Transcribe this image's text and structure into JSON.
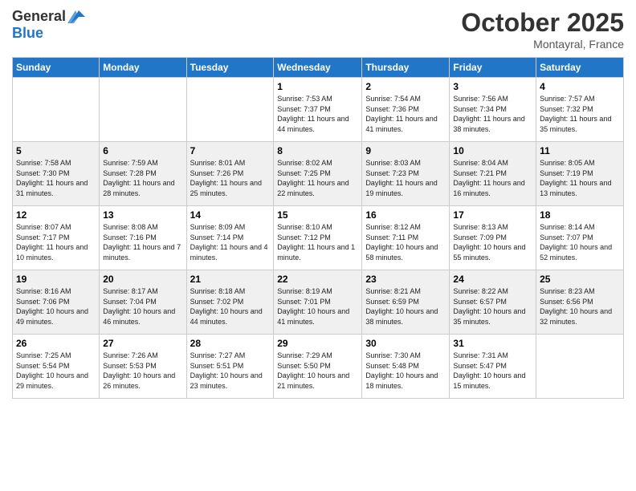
{
  "header": {
    "logo_line1": "General",
    "logo_line2": "Blue",
    "month": "October 2025",
    "location": "Montayral, France"
  },
  "days_of_week": [
    "Sunday",
    "Monday",
    "Tuesday",
    "Wednesday",
    "Thursday",
    "Friday",
    "Saturday"
  ],
  "weeks": [
    [
      {
        "day": "",
        "sunrise": "",
        "sunset": "",
        "daylight": ""
      },
      {
        "day": "",
        "sunrise": "",
        "sunset": "",
        "daylight": ""
      },
      {
        "day": "",
        "sunrise": "",
        "sunset": "",
        "daylight": ""
      },
      {
        "day": "1",
        "sunrise": "Sunrise: 7:53 AM",
        "sunset": "Sunset: 7:37 PM",
        "daylight": "Daylight: 11 hours and 44 minutes."
      },
      {
        "day": "2",
        "sunrise": "Sunrise: 7:54 AM",
        "sunset": "Sunset: 7:36 PM",
        "daylight": "Daylight: 11 hours and 41 minutes."
      },
      {
        "day": "3",
        "sunrise": "Sunrise: 7:56 AM",
        "sunset": "Sunset: 7:34 PM",
        "daylight": "Daylight: 11 hours and 38 minutes."
      },
      {
        "day": "4",
        "sunrise": "Sunrise: 7:57 AM",
        "sunset": "Sunset: 7:32 PM",
        "daylight": "Daylight: 11 hours and 35 minutes."
      }
    ],
    [
      {
        "day": "5",
        "sunrise": "Sunrise: 7:58 AM",
        "sunset": "Sunset: 7:30 PM",
        "daylight": "Daylight: 11 hours and 31 minutes."
      },
      {
        "day": "6",
        "sunrise": "Sunrise: 7:59 AM",
        "sunset": "Sunset: 7:28 PM",
        "daylight": "Daylight: 11 hours and 28 minutes."
      },
      {
        "day": "7",
        "sunrise": "Sunrise: 8:01 AM",
        "sunset": "Sunset: 7:26 PM",
        "daylight": "Daylight: 11 hours and 25 minutes."
      },
      {
        "day": "8",
        "sunrise": "Sunrise: 8:02 AM",
        "sunset": "Sunset: 7:25 PM",
        "daylight": "Daylight: 11 hours and 22 minutes."
      },
      {
        "day": "9",
        "sunrise": "Sunrise: 8:03 AM",
        "sunset": "Sunset: 7:23 PM",
        "daylight": "Daylight: 11 hours and 19 minutes."
      },
      {
        "day": "10",
        "sunrise": "Sunrise: 8:04 AM",
        "sunset": "Sunset: 7:21 PM",
        "daylight": "Daylight: 11 hours and 16 minutes."
      },
      {
        "day": "11",
        "sunrise": "Sunrise: 8:05 AM",
        "sunset": "Sunset: 7:19 PM",
        "daylight": "Daylight: 11 hours and 13 minutes."
      }
    ],
    [
      {
        "day": "12",
        "sunrise": "Sunrise: 8:07 AM",
        "sunset": "Sunset: 7:17 PM",
        "daylight": "Daylight: 11 hours and 10 minutes."
      },
      {
        "day": "13",
        "sunrise": "Sunrise: 8:08 AM",
        "sunset": "Sunset: 7:16 PM",
        "daylight": "Daylight: 11 hours and 7 minutes."
      },
      {
        "day": "14",
        "sunrise": "Sunrise: 8:09 AM",
        "sunset": "Sunset: 7:14 PM",
        "daylight": "Daylight: 11 hours and 4 minutes."
      },
      {
        "day": "15",
        "sunrise": "Sunrise: 8:10 AM",
        "sunset": "Sunset: 7:12 PM",
        "daylight": "Daylight: 11 hours and 1 minute."
      },
      {
        "day": "16",
        "sunrise": "Sunrise: 8:12 AM",
        "sunset": "Sunset: 7:11 PM",
        "daylight": "Daylight: 10 hours and 58 minutes."
      },
      {
        "day": "17",
        "sunrise": "Sunrise: 8:13 AM",
        "sunset": "Sunset: 7:09 PM",
        "daylight": "Daylight: 10 hours and 55 minutes."
      },
      {
        "day": "18",
        "sunrise": "Sunrise: 8:14 AM",
        "sunset": "Sunset: 7:07 PM",
        "daylight": "Daylight: 10 hours and 52 minutes."
      }
    ],
    [
      {
        "day": "19",
        "sunrise": "Sunrise: 8:16 AM",
        "sunset": "Sunset: 7:06 PM",
        "daylight": "Daylight: 10 hours and 49 minutes."
      },
      {
        "day": "20",
        "sunrise": "Sunrise: 8:17 AM",
        "sunset": "Sunset: 7:04 PM",
        "daylight": "Daylight: 10 hours and 46 minutes."
      },
      {
        "day": "21",
        "sunrise": "Sunrise: 8:18 AM",
        "sunset": "Sunset: 7:02 PM",
        "daylight": "Daylight: 10 hours and 44 minutes."
      },
      {
        "day": "22",
        "sunrise": "Sunrise: 8:19 AM",
        "sunset": "Sunset: 7:01 PM",
        "daylight": "Daylight: 10 hours and 41 minutes."
      },
      {
        "day": "23",
        "sunrise": "Sunrise: 8:21 AM",
        "sunset": "Sunset: 6:59 PM",
        "daylight": "Daylight: 10 hours and 38 minutes."
      },
      {
        "day": "24",
        "sunrise": "Sunrise: 8:22 AM",
        "sunset": "Sunset: 6:57 PM",
        "daylight": "Daylight: 10 hours and 35 minutes."
      },
      {
        "day": "25",
        "sunrise": "Sunrise: 8:23 AM",
        "sunset": "Sunset: 6:56 PM",
        "daylight": "Daylight: 10 hours and 32 minutes."
      }
    ],
    [
      {
        "day": "26",
        "sunrise": "Sunrise: 7:25 AM",
        "sunset": "Sunset: 5:54 PM",
        "daylight": "Daylight: 10 hours and 29 minutes."
      },
      {
        "day": "27",
        "sunrise": "Sunrise: 7:26 AM",
        "sunset": "Sunset: 5:53 PM",
        "daylight": "Daylight: 10 hours and 26 minutes."
      },
      {
        "day": "28",
        "sunrise": "Sunrise: 7:27 AM",
        "sunset": "Sunset: 5:51 PM",
        "daylight": "Daylight: 10 hours and 23 minutes."
      },
      {
        "day": "29",
        "sunrise": "Sunrise: 7:29 AM",
        "sunset": "Sunset: 5:50 PM",
        "daylight": "Daylight: 10 hours and 21 minutes."
      },
      {
        "day": "30",
        "sunrise": "Sunrise: 7:30 AM",
        "sunset": "Sunset: 5:48 PM",
        "daylight": "Daylight: 10 hours and 18 minutes."
      },
      {
        "day": "31",
        "sunrise": "Sunrise: 7:31 AM",
        "sunset": "Sunset: 5:47 PM",
        "daylight": "Daylight: 10 hours and 15 minutes."
      },
      {
        "day": "",
        "sunrise": "",
        "sunset": "",
        "daylight": ""
      }
    ]
  ]
}
